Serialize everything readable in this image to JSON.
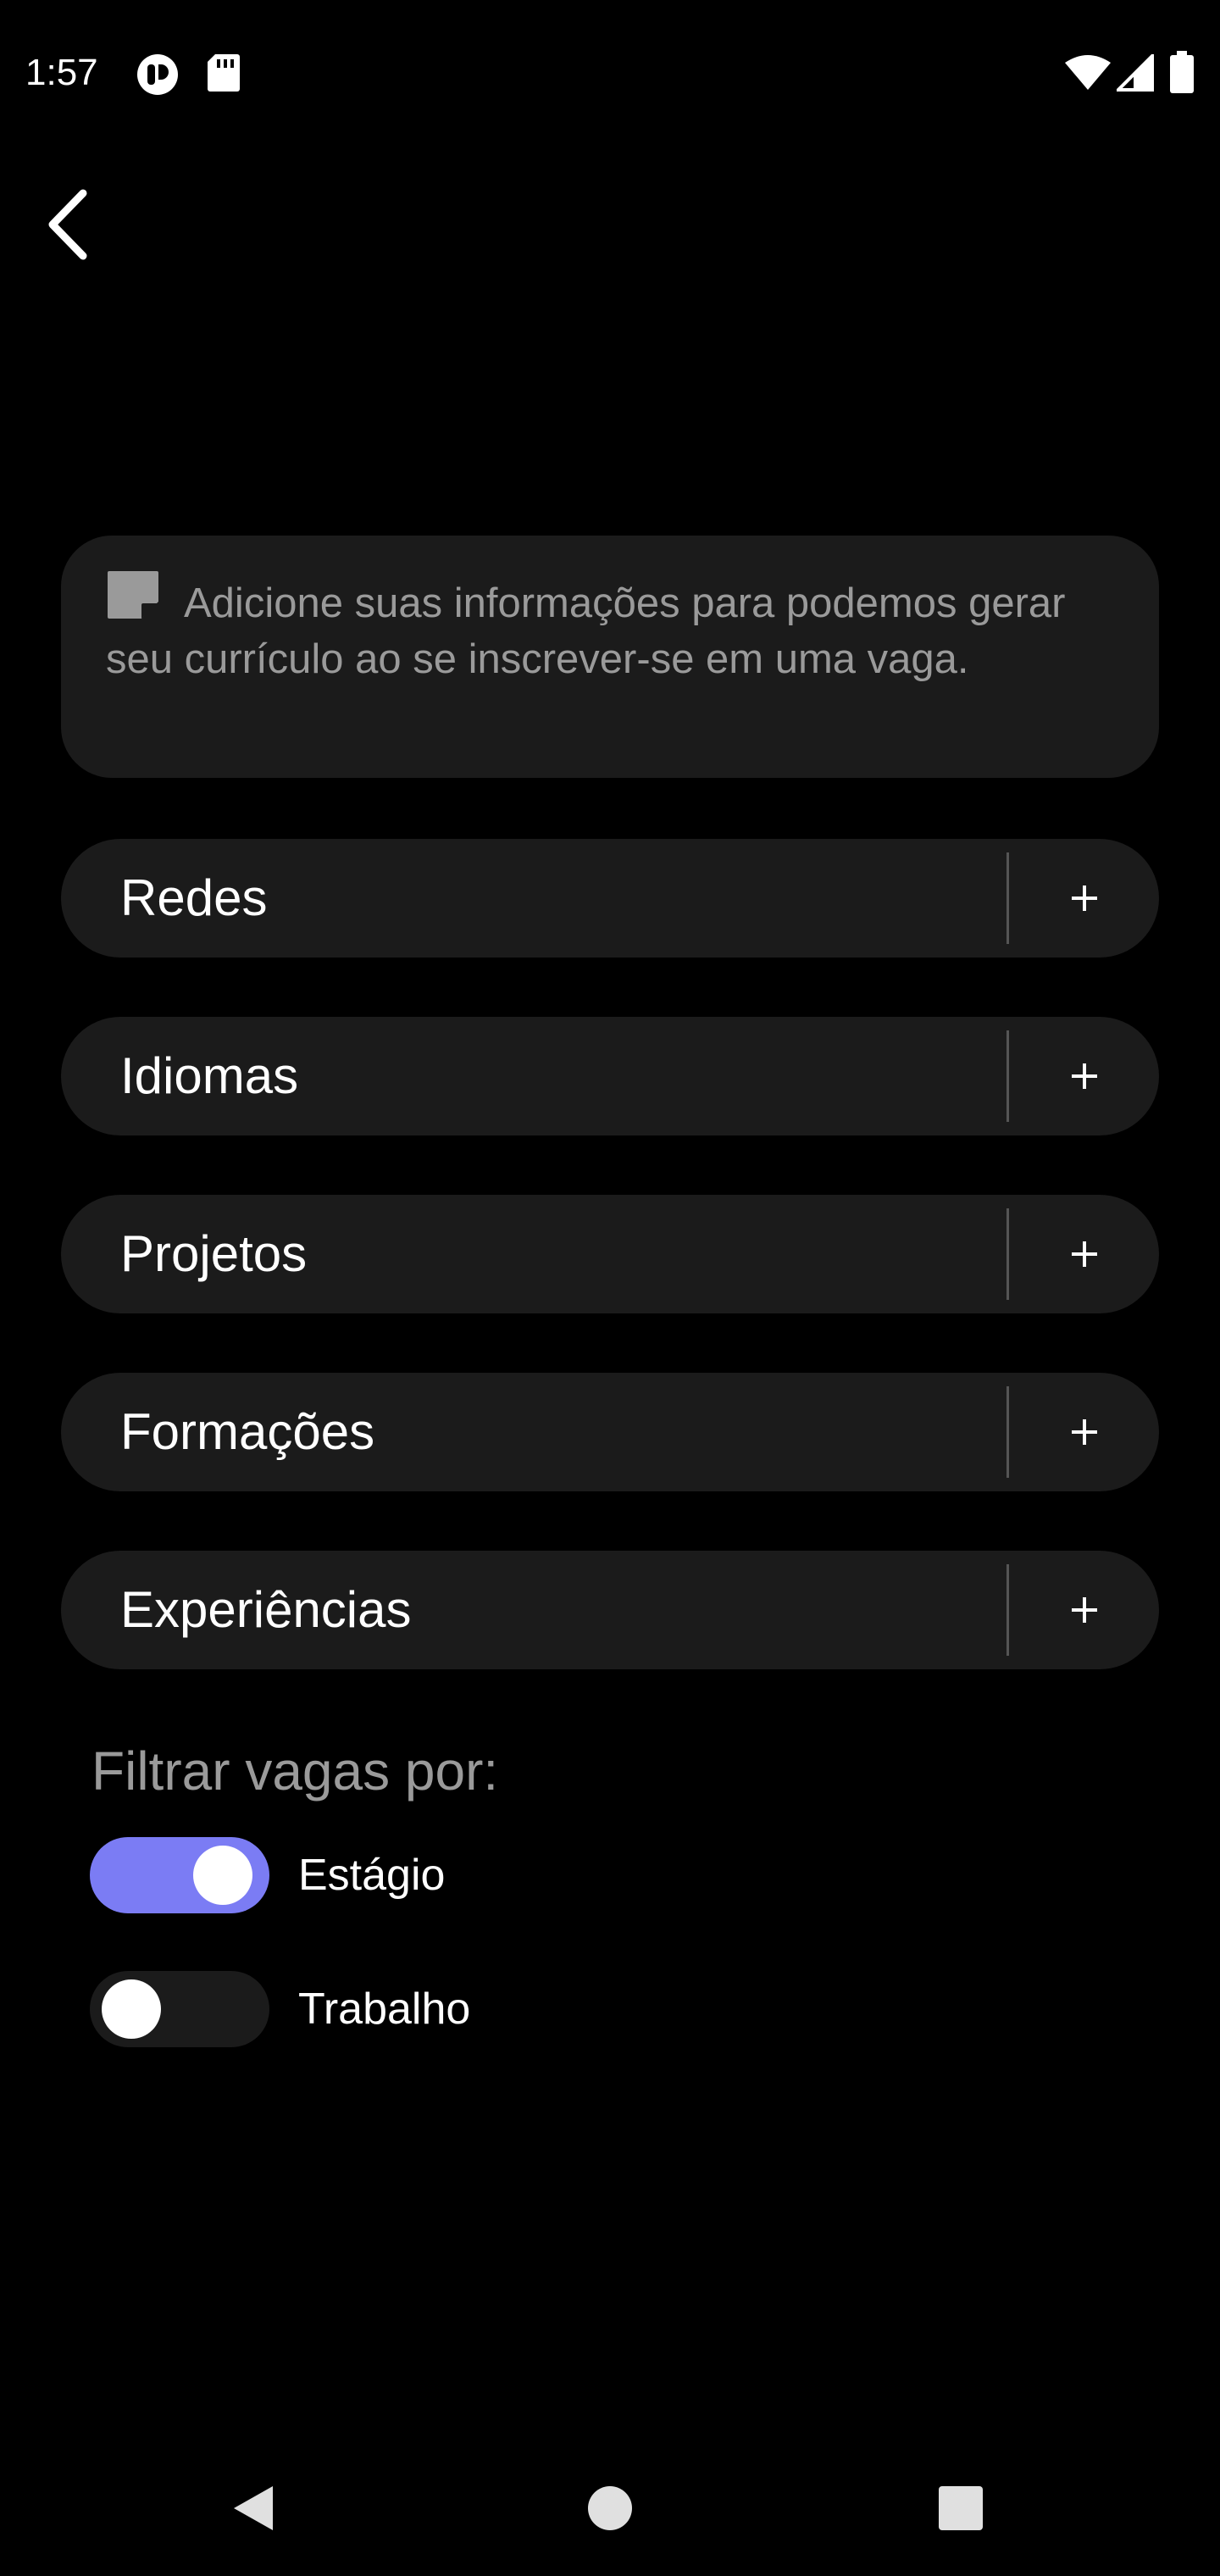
{
  "status_bar": {
    "time": "1:57",
    "left_icons": [
      "podcast-app-icon",
      "sd-card-icon"
    ],
    "right_icons": [
      "wifi-icon",
      "cellular-signal-icon",
      "battery-icon"
    ]
  },
  "header": {
    "back_icon": "chevron-left-icon"
  },
  "info_card": {
    "icon": "note-icon",
    "text": "Adicione suas informações para podemos gerar seu currículo ao se inscrever-se em uma vaga."
  },
  "sections": [
    {
      "label": "Redes",
      "action": "+"
    },
    {
      "label": "Idiomas",
      "action": "+"
    },
    {
      "label": "Projetos",
      "action": "+"
    },
    {
      "label": "Formações",
      "action": "+"
    },
    {
      "label": "Experiências",
      "action": "+"
    }
  ],
  "filter": {
    "title": "Filtrar vagas por:",
    "options": [
      {
        "label": "Estágio",
        "enabled": true
      },
      {
        "label": "Trabalho",
        "enabled": false
      }
    ]
  },
  "colors": {
    "background": "#000000",
    "card": "#1b1b1b",
    "accent": "#7b7cf4",
    "toggle_off": "#1b1b1b",
    "muted_text": "#9a9a9a"
  },
  "nav_bar": {
    "icons": [
      "nav-back-icon",
      "nav-home-icon",
      "nav-recents-icon"
    ]
  }
}
